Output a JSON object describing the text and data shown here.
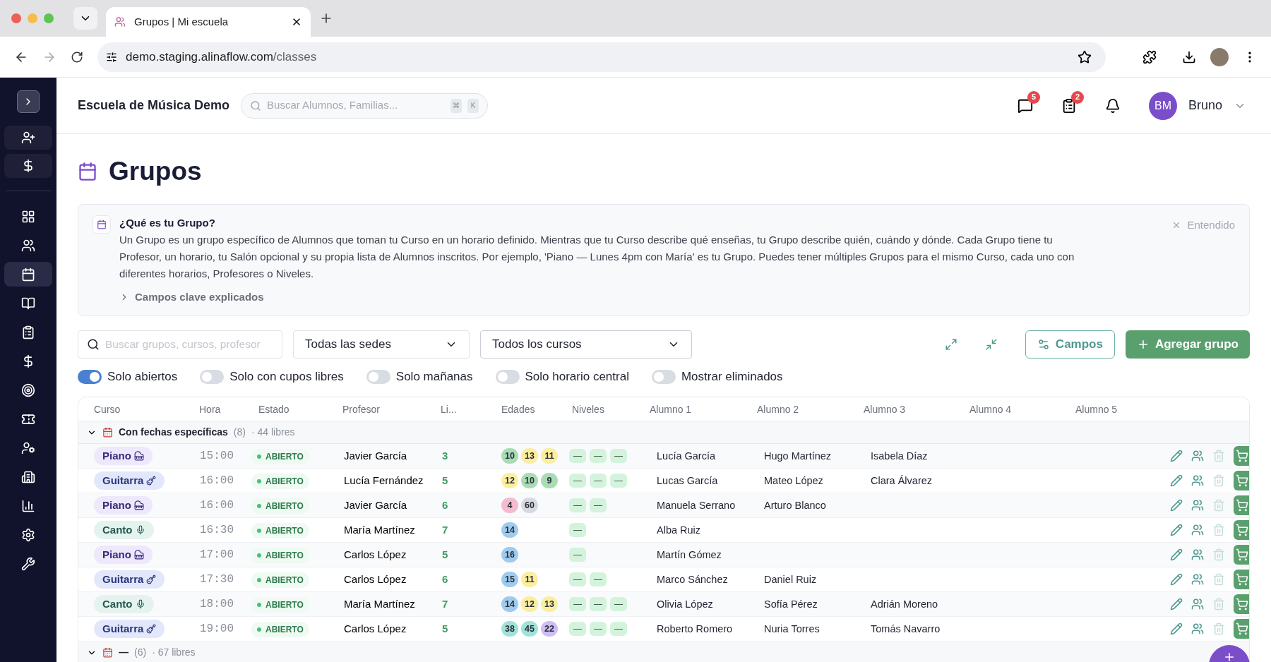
{
  "browser": {
    "tab_title": "Grupos | Mi escuela",
    "url_host": "demo.staging.alinaflow.com",
    "url_path": "/classes"
  },
  "sidebar": {
    "quick_actions": [
      {
        "selected": false
      },
      {
        "selected": false
      }
    ],
    "nav": [
      {
        "selected": false
      },
      {
        "selected": false
      },
      {
        "selected": true
      },
      {
        "selected": false
      },
      {
        "selected": false
      },
      {
        "selected": false
      },
      {
        "selected": false
      },
      {
        "selected": false
      },
      {
        "selected": false
      },
      {
        "selected": false
      },
      {
        "selected": false
      },
      {
        "selected": false
      },
      {
        "selected": false
      }
    ]
  },
  "header": {
    "school": "Escuela de Música Demo",
    "search_placeholder": "Buscar Alumnos, Familias...",
    "shortcut": [
      "⌘",
      "K"
    ],
    "messages_badge": "5",
    "tasks_badge": "2",
    "avatar_initials": "BM",
    "user": "Bruno"
  },
  "page_title": "Grupos",
  "info": {
    "title": "¿Qué es tu Grupo?",
    "body": "Un Grupo es un grupo específico de Alumnos que toman tu Curso en un horario definido. Mientras que tu Curso describe qué enseñas, tu Grupo describe quién, cuándo y dónde. Cada Grupo tiene tu Profesor, un horario, tu Salón opcional y su propia lista de Alumnos inscritos. Por ejemplo, 'Piano — Lunes 4pm con María' es tu Grupo. Puedes tener múltiples Grupos para el mismo Curso, cada uno con diferentes horarios, Profesores o Niveles.",
    "expander": "Campos clave explicados",
    "expanded": false,
    "dismiss": "Entendido"
  },
  "filters": {
    "search_placeholder": "Buscar grupos, cursos, profesor",
    "location": "Todas las sedes",
    "course": "Todos los cursos",
    "fields_button": "Campos",
    "add_button": "Agregar grupo"
  },
  "toggles": [
    {
      "label": "Solo abiertos",
      "on": true
    },
    {
      "label": "Solo con cupos libres",
      "on": false
    },
    {
      "label": "Solo mañanas",
      "on": false
    },
    {
      "label": "Solo horario central",
      "on": false
    },
    {
      "label": "Mostrar eliminados",
      "on": false
    }
  ],
  "table": {
    "columns": [
      "Curso",
      "Hora",
      "Estado",
      "Profesor",
      "Li...",
      "Edades",
      "Niveles",
      "Alumno 1",
      "Alumno 2",
      "Alumno 3",
      "Alumno 4",
      "Alumno 5"
    ],
    "groups": [
      {
        "label": "Con fechas específicas",
        "count": "(8)",
        "free": "· 44 libres",
        "expanded": true,
        "rows": [
          {
            "course": {
              "name": "Piano",
              "kind": "piano"
            },
            "time": "15:00",
            "status": "ABIERTO",
            "teacher": "Javier García",
            "free": "3",
            "ages": [
              {
                "value": "10",
                "color": "#a8dcb5"
              },
              {
                "value": "13",
                "color": "#fbee9f"
              },
              {
                "value": "11",
                "color": "#fbee9f"
              }
            ],
            "levels": [
              "—",
              "—",
              "—"
            ],
            "students": [
              "Lucía García",
              "Hugo Martínez",
              "Isabela Díaz"
            ]
          },
          {
            "course": {
              "name": "Guitarra",
              "kind": "guitar"
            },
            "time": "16:00",
            "status": "ABIERTO",
            "teacher": "Lucía Fernández",
            "free": "5",
            "ages": [
              {
                "value": "12",
                "color": "#fbee9f"
              },
              {
                "value": "10",
                "color": "#a8dcb5"
              },
              {
                "value": "9",
                "color": "#a8dcb5"
              }
            ],
            "levels": [
              "—",
              "—",
              "—"
            ],
            "students": [
              "Lucas García",
              "Mateo López",
              "Clara Álvarez"
            ]
          },
          {
            "course": {
              "name": "Piano",
              "kind": "piano"
            },
            "time": "16:00",
            "status": "ABIERTO",
            "teacher": "Javier García",
            "free": "6",
            "ages": [
              {
                "value": "4",
                "color": "#f5bcd0"
              },
              {
                "value": "60",
                "color": "#d7dae1"
              }
            ],
            "levels": [
              "—",
              "—"
            ],
            "students": [
              "Manuela Serrano",
              "Arturo Blanco"
            ]
          },
          {
            "course": {
              "name": "Canto",
              "kind": "voice"
            },
            "time": "16:30",
            "status": "ABIERTO",
            "teacher": "María Martínez",
            "free": "7",
            "ages": [
              {
                "value": "14",
                "color": "#9ecbee"
              }
            ],
            "levels": [
              "—"
            ],
            "students": [
              "Alba Ruiz"
            ]
          },
          {
            "course": {
              "name": "Piano",
              "kind": "piano"
            },
            "time": "17:00",
            "status": "ABIERTO",
            "teacher": "Carlos López",
            "free": "5",
            "ages": [
              {
                "value": "16",
                "color": "#9ecbee"
              }
            ],
            "levels": [
              "—"
            ],
            "students": [
              "Martín Gómez"
            ]
          },
          {
            "course": {
              "name": "Guitarra",
              "kind": "guitar"
            },
            "time": "17:30",
            "status": "ABIERTO",
            "teacher": "Carlos López",
            "free": "6",
            "ages": [
              {
                "value": "15",
                "color": "#9ecbee"
              },
              {
                "value": "11",
                "color": "#fbee9f"
              }
            ],
            "levels": [
              "—",
              "—"
            ],
            "students": [
              "Marco Sánchez",
              "Daniel Ruiz"
            ]
          },
          {
            "course": {
              "name": "Canto",
              "kind": "voice"
            },
            "time": "18:00",
            "status": "ABIERTO",
            "teacher": "María Martínez",
            "free": "7",
            "ages": [
              {
                "value": "14",
                "color": "#9ecbee"
              },
              {
                "value": "12",
                "color": "#fbee9f"
              },
              {
                "value": "13",
                "color": "#fbee9f"
              }
            ],
            "levels": [
              "—",
              "—",
              "—"
            ],
            "students": [
              "Olivia López",
              "Sofía Pérez",
              "Adrián Moreno"
            ]
          },
          {
            "course": {
              "name": "Guitarra",
              "kind": "guitar"
            },
            "time": "19:00",
            "status": "ABIERTO",
            "teacher": "Carlos López",
            "free": "5",
            "ages": [
              {
                "value": "38",
                "color": "#a0e2d8"
              },
              {
                "value": "45",
                "color": "#a0e2d8"
              },
              {
                "value": "22",
                "color": "#d0bdf3"
              }
            ],
            "levels": [
              "—",
              "—",
              "—"
            ],
            "students": [
              "Roberto Romero",
              "Nuria Torres",
              "Tomás Navarro"
            ]
          }
        ]
      },
      {
        "label": "—",
        "count": "(6)",
        "free": "· 67 libres",
        "expanded": true
      }
    ]
  }
}
